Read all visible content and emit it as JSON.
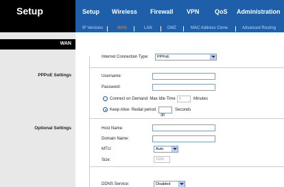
{
  "brand": {
    "title": "Setup"
  },
  "main_tabs": [
    {
      "label": "Setup",
      "active": true
    },
    {
      "label": "Wireless",
      "active": false
    },
    {
      "label": "Firewall",
      "active": false
    },
    {
      "label": "VPN",
      "active": false
    },
    {
      "label": "QoS",
      "active": false
    },
    {
      "label": "Administration",
      "active": false
    }
  ],
  "sub_tabs": [
    {
      "label": "IP Versions",
      "current": false
    },
    {
      "label": "WAN",
      "current": true
    },
    {
      "label": "LAN",
      "current": false
    },
    {
      "label": "DMZ",
      "current": false
    },
    {
      "label": "MAC Address Clone",
      "current": false
    },
    {
      "label": "Advanced Routing",
      "current": false
    }
  ],
  "left": {
    "section_title": "WAN",
    "pppoe_label": "PPPoE Settings",
    "optional_label": "Optional Settings"
  },
  "connection": {
    "type_label": "Internet Connection Type:",
    "type_value": "PPPoE"
  },
  "pppoe": {
    "username_label": "Username:",
    "username_value": "",
    "password_label": "Password:",
    "password_value": "",
    "connect_on_demand_label": "Connect on Demand: Max Idle Time",
    "max_idle_value": "5",
    "minutes_label": "Minutes",
    "keep_alive_label": "Keep Alive: Redial period",
    "redial_value": "30",
    "seconds_label": "Seconds"
  },
  "optional": {
    "host_name_label": "Host Name:",
    "host_name_value": "",
    "domain_name_label": "Domain Name:",
    "domain_name_value": "",
    "mtu_label": "MTU:",
    "mtu_value": "Auto",
    "size_label": "Size:",
    "size_value": "1500"
  },
  "ddns": {
    "label": "DDNS Service:",
    "value": "Disabled"
  },
  "colors": {
    "header_bg": "#000000",
    "tab_bar_bg": "#1f5ea8",
    "current_subtab": "#ff8c1a",
    "radio_selected": "#1a9a2c"
  }
}
